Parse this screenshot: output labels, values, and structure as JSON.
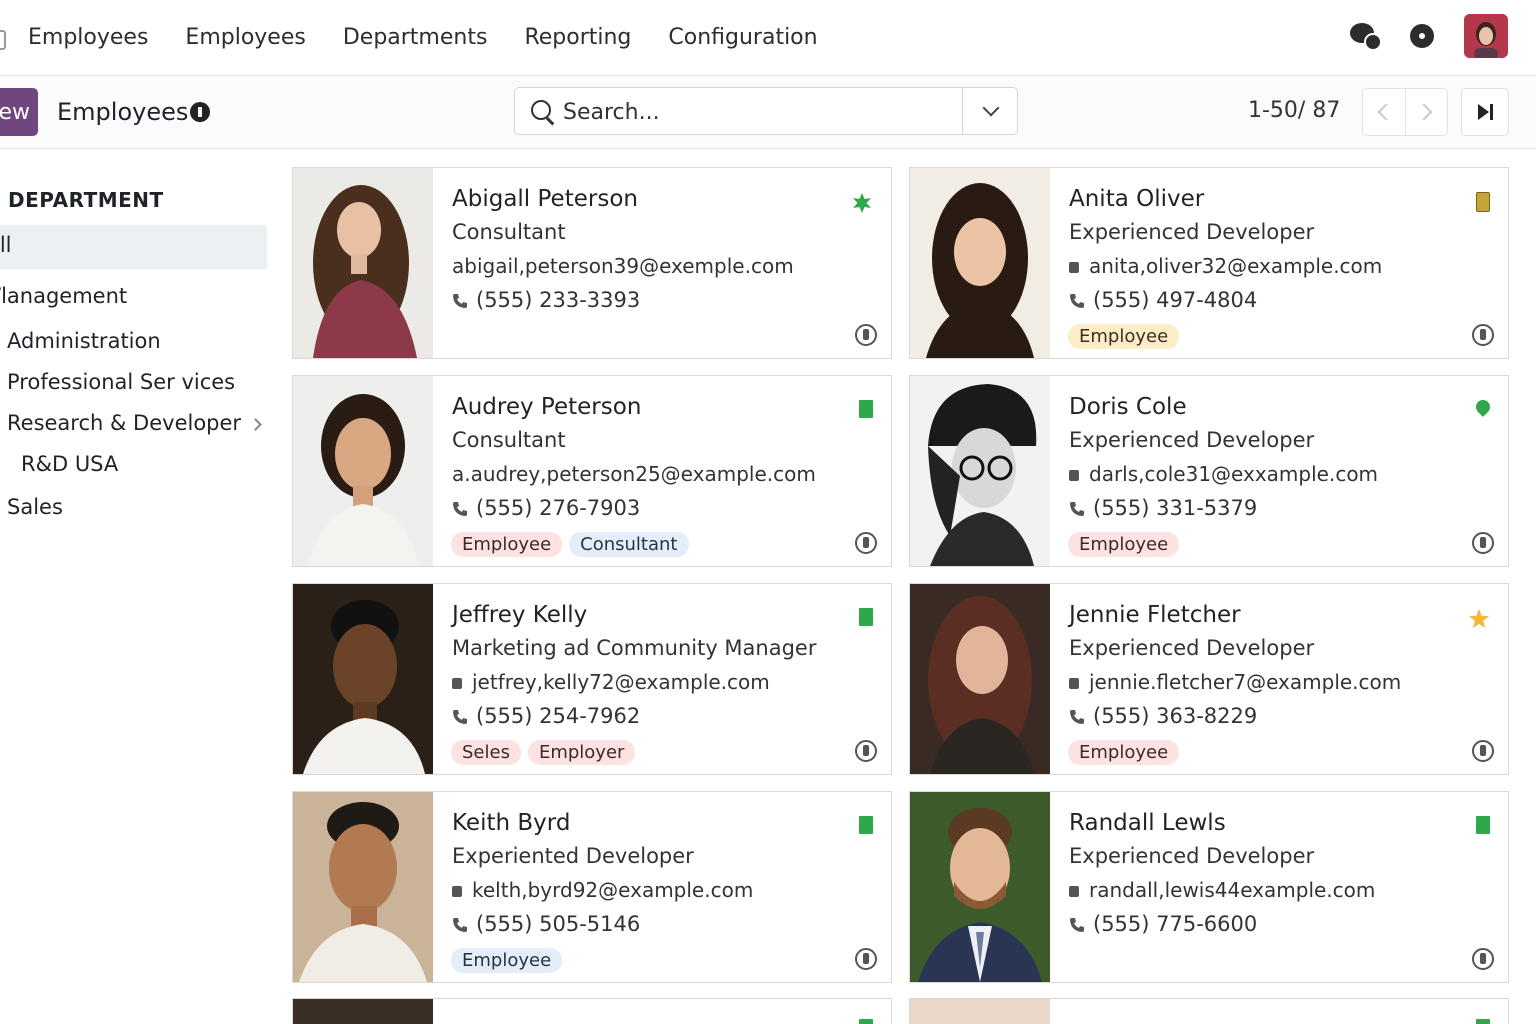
{
  "topnav": {
    "menu": [
      "Employees",
      "Employees",
      "Departments",
      "Reporting",
      "Configuration"
    ]
  },
  "controlbar": {
    "new_label": "ew",
    "title": "Employees",
    "search_placeholder": "Search...",
    "pager": "1-50/ 87"
  },
  "sidebar": {
    "heading": "DEPARTMENT",
    "items": [
      "ill",
      "/lanagement",
      "Administration",
      "Professional Ser vices",
      "Research & Developer",
      "R&D USA",
      "Sales"
    ]
  },
  "employees": [
    {
      "name": "Abigall Peterson",
      "job": "Consultant",
      "email": "abigail,peterson39@exemple.com",
      "phone": "(555)  233-3393",
      "tags": [],
      "status": "star-badge-icon"
    },
    {
      "name": "Anita Oliver",
      "job": "Experienced Developer",
      "email": "anita,oliver32@example.com",
      "phone": "(555)  497-4804",
      "tags": [
        "Employee"
      ],
      "status": "book-icon"
    },
    {
      "name": "Audrey Peterson",
      "job": "Consultant",
      "email": "a.audrey,peterson25@example.com",
      "phone": "(555)  276-7903",
      "tags": [
        "Employee",
        "Consultant"
      ],
      "status": "presence-square-icon"
    },
    {
      "name": "Doris Cole",
      "job": "Experienced Developer",
      "email": "darls,cole31@exxample.com",
      "phone": "(555)  331-5379",
      "tags": [
        "Employee"
      ],
      "status": "location-pin-icon"
    },
    {
      "name": "Jeffrey Kelly",
      "job": "Marketing ad  Community Manager",
      "email": "jetfrey,kelly72@example.com",
      "phone": "(555)  254-7962",
      "tags": [
        "Seles",
        "Employer"
      ],
      "status": "presence-square-icon"
    },
    {
      "name": "Jennie Fletcher",
      "job": "Experienced Developer",
      "email": "jennie.fletcher7@example.com",
      "phone": "(555)  363-8229",
      "tags": [
        "Employee"
      ],
      "status": "star-icon"
    },
    {
      "name": "Keith Byrd",
      "job": "Experiented Developer",
      "email": "kelth,byrd92@example.com",
      "phone": "(555)  505-5146",
      "tags": [
        "Employee"
      ],
      "status": "presence-square-icon"
    },
    {
      "name": "Randall Lewls",
      "job": "Experienced Developer",
      "email": "randall,lewis44example.com",
      "phone": "(555)  775-6600",
      "tags": [],
      "status": "presence-square-icon"
    }
  ],
  "colors": {
    "brand": "#71467f",
    "presence": "#2ea84b",
    "star": "#f3b73a",
    "tag_red": "#fde2e2",
    "tag_blue": "#e3eefa",
    "tag_amber": "#fdecc8"
  }
}
